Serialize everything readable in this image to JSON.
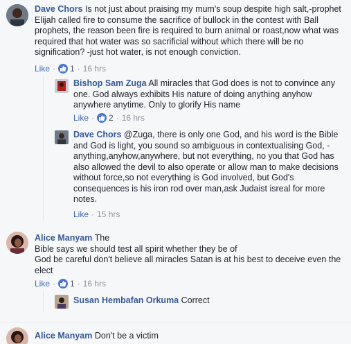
{
  "comments": [
    {
      "author": "Dave Chors",
      "text": " Is not just about praising my mum's soup despite high salt,-prophet Elijah called fire to consume the sacrifice of bullock in the contest with Ball prophets, the reason been fire is required to burn animal or roast,now what was required that hot water was so sacrificial without which there will be no signification? -just hot water, is not enough conviction.",
      "like_label": "Like",
      "reactions": "1",
      "time": "16 hrs"
    },
    {
      "author": "Bishop Sam Zuga",
      "text": " All miracles that God does is not to convince any one. God always exhibits His nature of doing anything anyhow anywhere anytime. Only to glorify His name",
      "like_label": "Like",
      "reactions": "2",
      "time": "16 hrs"
    },
    {
      "author": "Dave Chors",
      "text": " @Zuga, there is only one God, and his word is the Bible and God is light, you sound so ambiguous in contextualising God, -anything,anyhow,anywhere, but not everything, no you that God has also allowed the devil to also operate or allow man to make decisions without force,so not everything is God involved, but God's consequences is his iron rod over man,ask Judaist isreal for more notes.",
      "like_label": "Like",
      "time": "15 hrs"
    },
    {
      "author": "Alice Manyam",
      "text_line1": " The",
      "text_line2": "Bible says we should test all spirit whether they be of",
      "text_line3": "God be careful don't believe all miracles Satan is at his best to deceive even the elect",
      "like_label": "Like",
      "reactions": "1",
      "time": "16 hrs"
    },
    {
      "author": "Susan Hembafan Orkuma",
      "text": " Correct"
    },
    {
      "author": "Alice Manyam",
      "text": " Don't be a victim"
    }
  ],
  "colors": {
    "author": "#365899",
    "like": "#4267b2",
    "meta": "#90949c",
    "badge": "#4a76d4"
  },
  "icons": [
    "thumbs-up-icon"
  ]
}
